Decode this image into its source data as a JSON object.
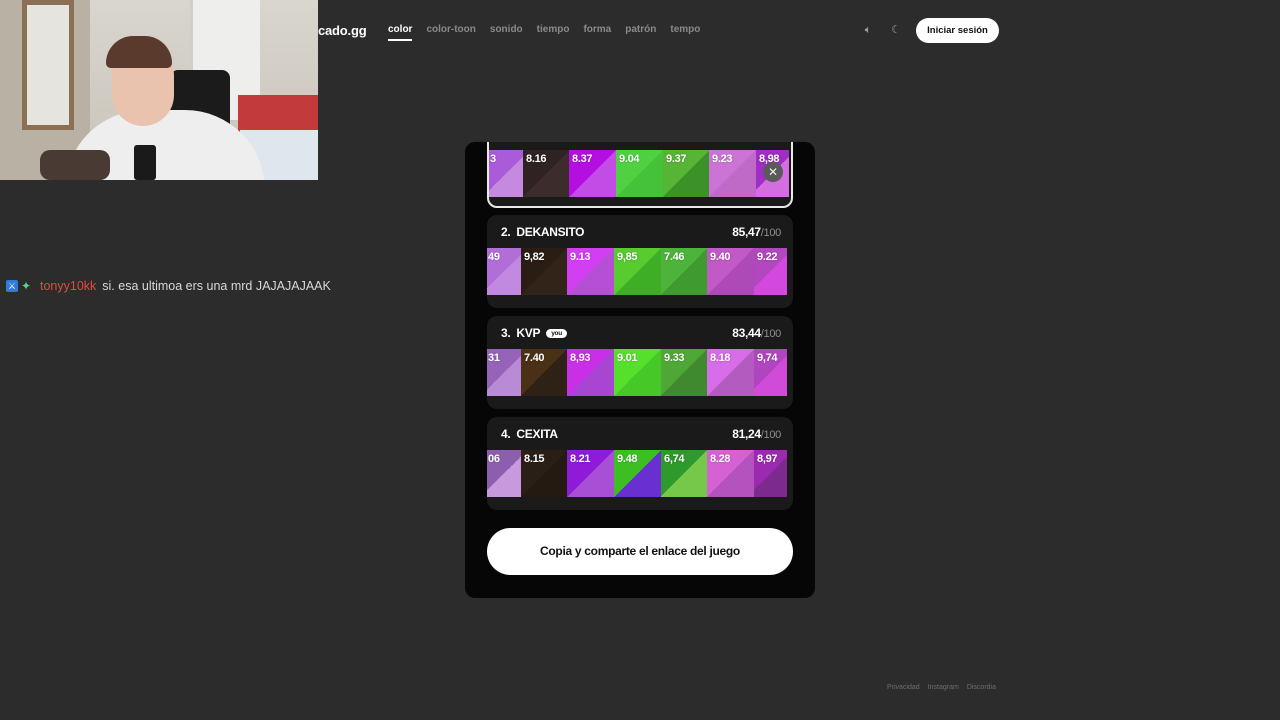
{
  "site": {
    "logo": "cado.gg"
  },
  "nav": {
    "tabs": [
      {
        "label": "color",
        "active": true
      },
      {
        "label": "color-toon"
      },
      {
        "label": "sonido"
      },
      {
        "label": "tiempo"
      },
      {
        "label": "forma"
      },
      {
        "label": "patrón",
        "dot": "#f2c230"
      },
      {
        "label": "tempo",
        "dot": "#e6335a"
      }
    ],
    "login_label": "Iniciar sesión",
    "icons": [
      "volume-icon",
      "moon-icon"
    ]
  },
  "chat": {
    "badges": [
      "mod-badge",
      "sparkle-badge"
    ],
    "username": "tonyy10kk",
    "message": "si. esa ultimoa ers una mrd JAJAJAJAAK"
  },
  "leaderboard": {
    "first_card": {
      "cells": [
        {
          "value": "3",
          "top": "#a95bd9",
          "bottom": "#c58ae0"
        },
        {
          "value": "8.16",
          "top": "#2e2222",
          "bottom": "#3c2c2b"
        },
        {
          "value": "8.37",
          "top": "#b40ee0",
          "bottom": "#c44ce6"
        },
        {
          "value": "9.04",
          "top": "#4fd141",
          "bottom": "#45c23a"
        },
        {
          "value": "9.37",
          "top": "#56b534",
          "bottom": "#3d9129"
        },
        {
          "value": "9.23",
          "top": "#cc74d6",
          "bottom": "#c06ac8"
        },
        {
          "value": "8,98",
          "top": "#a02dc8",
          "bottom": "#d36de0"
        }
      ]
    },
    "entries": [
      {
        "rank": "2.",
        "name": "DEKANSITO",
        "score": "85,47",
        "max": "/100",
        "you": false,
        "cells": [
          {
            "value": "49",
            "top": "#b26ed7",
            "bottom": "#c18ae0"
          },
          {
            "value": "9,82",
            "top": "#2a1d13",
            "bottom": "#33241a"
          },
          {
            "value": "9.13",
            "top": "#d23ff2",
            "bottom": "#b54fd4"
          },
          {
            "value": "9,85",
            "top": "#58cc2e",
            "bottom": "#3fae27"
          },
          {
            "value": "7.46",
            "top": "#4db33a",
            "bottom": "#3f9a30"
          },
          {
            "value": "9.40",
            "top": "#c159c7",
            "bottom": "#ad4ab8"
          },
          {
            "value": "9.22",
            "top": "#b247c0",
            "bottom": "#d548e0"
          }
        ]
      },
      {
        "rank": "3.",
        "name": "KVP",
        "score": "83,44",
        "max": "/100",
        "you": true,
        "you_label": "you",
        "cells": [
          {
            "value": "31",
            "top": "#9763b8",
            "bottom": "#b98ad6"
          },
          {
            "value": "7.40",
            "top": "#4a3116",
            "bottom": "#2e2115"
          },
          {
            "value": "8,93",
            "top": "#c82fe6",
            "bottom": "#a845d2"
          },
          {
            "value": "9.01",
            "top": "#56e02c",
            "bottom": "#46c928"
          },
          {
            "value": "9.33",
            "top": "#4fa836",
            "bottom": "#3f8a2e"
          },
          {
            "value": "8.18",
            "top": "#d76de8",
            "bottom": "#b45bc0"
          },
          {
            "value": "9,74",
            "top": "#b045c0",
            "bottom": "#cf4bd8"
          }
        ]
      },
      {
        "rank": "4.",
        "name": "CEXITA",
        "score": "81,24",
        "max": "/100",
        "you": false,
        "cells": [
          {
            "value": "06",
            "top": "#8c5fae",
            "bottom": "#c999dd"
          },
          {
            "value": "8.15",
            "top": "#2a1f16",
            "bottom": "#241a12"
          },
          {
            "value": "8.21",
            "top": "#8f1bd8",
            "bottom": "#a94fd5"
          },
          {
            "value": "9.48",
            "top": "#3dbf24",
            "bottom": "#6a2fd0"
          },
          {
            "value": "6,74",
            "top": "#2f9a2c",
            "bottom": "#76c84a"
          },
          {
            "value": "8.28",
            "top": "#d561d5",
            "bottom": "#b453bd"
          },
          {
            "value": "8,97",
            "top": "#9c2ab0",
            "bottom": "#7d2a8e"
          }
        ]
      }
    ],
    "copy_label": "Copia y comparte el enlace del juego"
  },
  "footer": {
    "links": [
      "Privacidad",
      "Instagram",
      "Discordia"
    ]
  }
}
